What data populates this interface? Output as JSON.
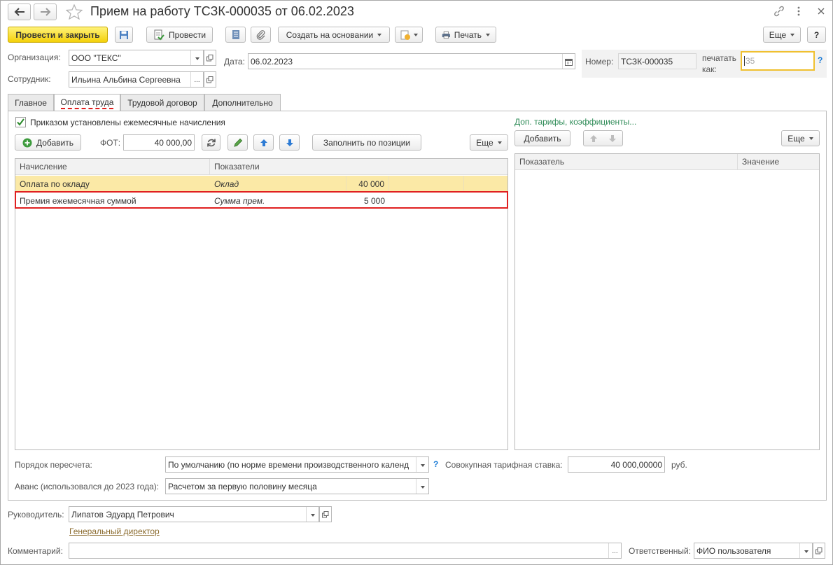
{
  "window": {
    "title": "Прием на работу ТСЗК-000035 от 06.02.2023"
  },
  "toolbar": {
    "post_close": "Провести и закрыть",
    "post": "Провести",
    "create_based": "Создать на основании",
    "print": "Печать",
    "more": "Еще",
    "help": "?"
  },
  "header": {
    "org_label": "Организация:",
    "org_value": "ООО \"ТЕКС\"",
    "date_label": "Дата:",
    "date_value": "06.02.2023",
    "number_label": "Номер:",
    "number_value": "ТСЗК-000035",
    "print_as_label_1": "печатать",
    "print_as_label_2": "как:",
    "print_as_value": "35",
    "help_q": "?",
    "employee_label": "Сотрудник:",
    "employee_value": "Ильина Альбина Сергеевна",
    "ellipsis": "..."
  },
  "tabs": [
    {
      "label": "Главное"
    },
    {
      "label": "Оплата труда"
    },
    {
      "label": "Трудовой договор"
    },
    {
      "label": "Дополнительно"
    }
  ],
  "pay": {
    "checkbox_label": "Приказом установлены ежемесячные начисления",
    "add": "Добавить",
    "fot_label": "ФОТ:",
    "fot_value": "40 000,00",
    "fill_by_position": "Заполнить по позиции",
    "more": "Еще",
    "columns": [
      "Начисление",
      "Показатели"
    ],
    "rows": [
      {
        "name": "Оплата по окладу",
        "indicator": "Оклад",
        "value": "40 000"
      },
      {
        "name": "Премия ежемесячная суммой",
        "indicator": "Сумма прем.",
        "value": "5 000"
      }
    ]
  },
  "extra": {
    "link": "Доп. тарифы, коэффициенты...",
    "add": "Добавить",
    "more": "Еще",
    "columns": [
      "Показатель",
      "Значение"
    ]
  },
  "bottom": {
    "recalc_label": "Порядок пересчета:",
    "recalc_value": "По умолчанию (по норме времени производственного календ",
    "help_q": "?",
    "total_rate_label": "Совокупная тарифная ставка:",
    "total_rate_value": "40 000,00000",
    "rub": "руб.",
    "advance_label": "Аванс (использовался до 2023 года):",
    "advance_value": "Расчетом за первую половину месяца"
  },
  "footer": {
    "manager_label": "Руководитель:",
    "manager_value": "Липатов Эдуард Петрович",
    "manager_position": "Генеральный директор",
    "comment_label": "Комментарий:",
    "comment_value": "",
    "ellipsis": "...",
    "responsible_label": "Ответственный:",
    "responsible_value": "ФИО пользователя"
  },
  "colors": {
    "accent_yellow": "#f4d10a",
    "row_selected": "#fbe9a6",
    "highlight_red": "#e02020",
    "link_green": "#2e8b57",
    "link_brown": "#8b6b2e"
  }
}
